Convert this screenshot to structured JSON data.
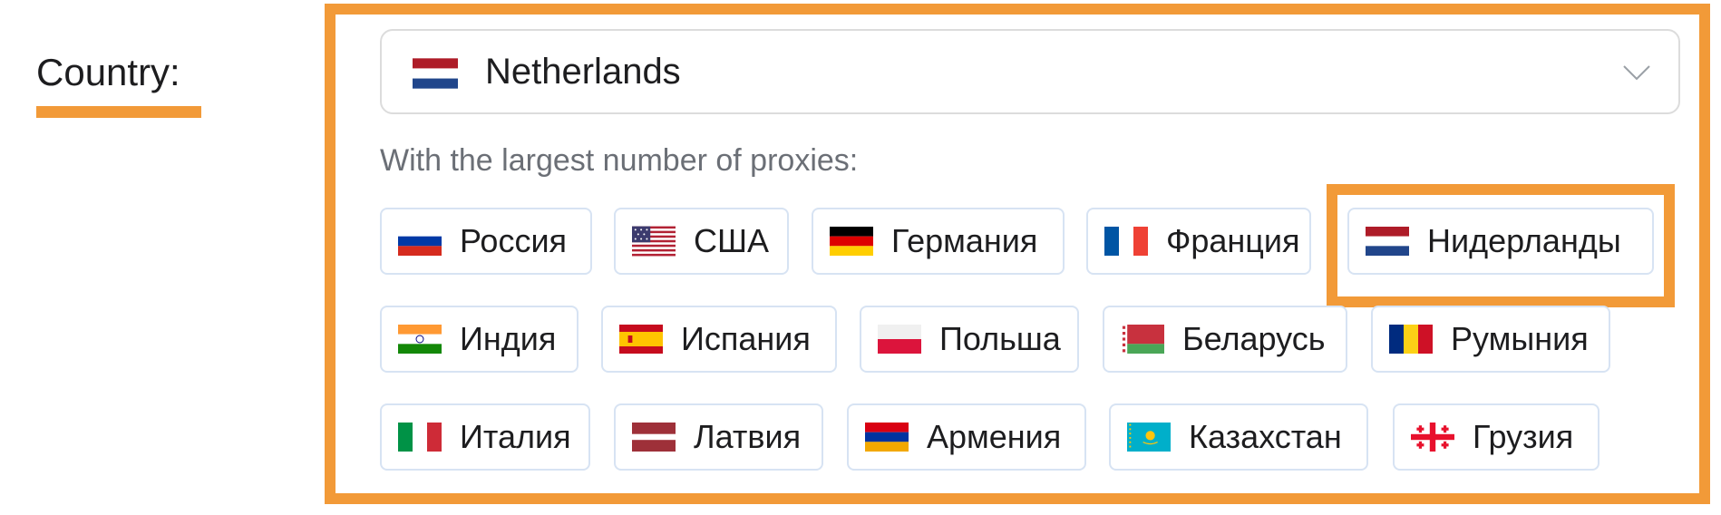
{
  "field": {
    "label": "Country:"
  },
  "select": {
    "value": "Netherlands",
    "flag": "flag-netherlands-icon"
  },
  "hint": "With the largest number of proxies:",
  "countries": [
    {
      "name": "Россия",
      "flag": "russia"
    },
    {
      "name": "США",
      "flag": "usa"
    },
    {
      "name": "Германия",
      "flag": "germany"
    },
    {
      "name": "Франция",
      "flag": "france"
    },
    {
      "name": "Нидерланды",
      "flag": "netherlands"
    },
    {
      "name": "Индия",
      "flag": "india"
    },
    {
      "name": "Испания",
      "flag": "spain"
    },
    {
      "name": "Польша",
      "flag": "poland"
    },
    {
      "name": "Беларусь",
      "flag": "belarus"
    },
    {
      "name": "Румыния",
      "flag": "romania"
    },
    {
      "name": "Италия",
      "flag": "italy"
    },
    {
      "name": "Латвия",
      "flag": "latvia"
    },
    {
      "name": "Армения",
      "flag": "armenia"
    },
    {
      "name": "Казахстан",
      "flag": "kazakhstan"
    },
    {
      "name": "Грузия",
      "flag": "georgia"
    }
  ],
  "colors": {
    "accent": "#f29a38",
    "chip_border": "#d7e3f3",
    "select_border": "#dcdcdc"
  }
}
